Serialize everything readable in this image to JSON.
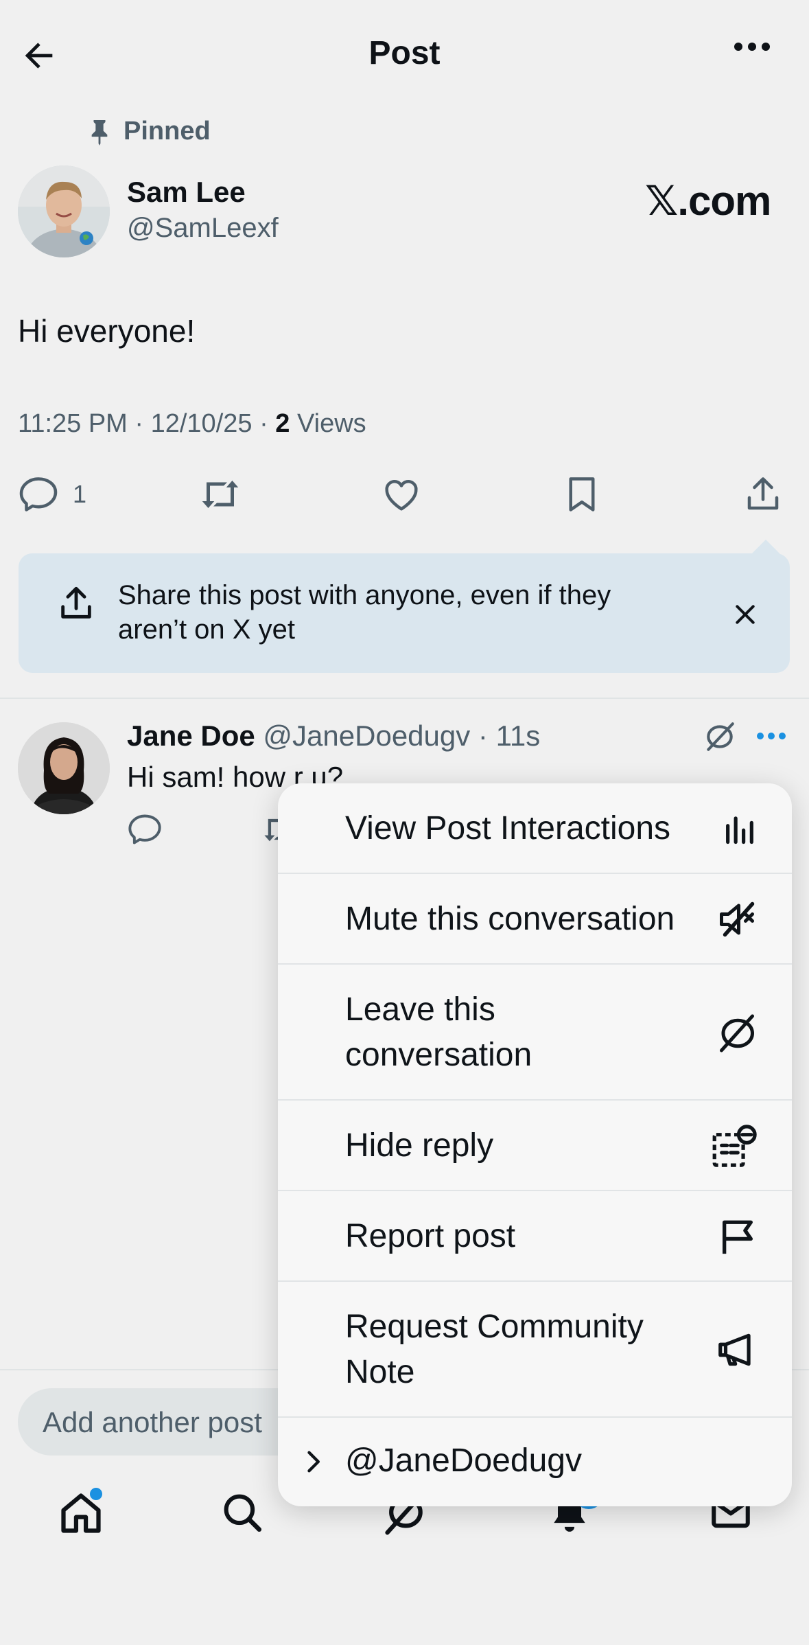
{
  "header": {
    "title": "Post"
  },
  "post": {
    "pinned_label": "Pinned",
    "author_name": "Sam Lee",
    "author_handle": "@SamLeexf",
    "brand_text": "𝕏.com",
    "text": "Hi everyone!",
    "time": "11:25 PM · 12/10/25 · ",
    "views_count": "2",
    "views_label": " Views",
    "reply_count": "1"
  },
  "share_banner": {
    "text": "Share this post with anyone, even if they aren’t on X yet"
  },
  "reply": {
    "author_name": "Jane Doe",
    "author_handle": "@JaneDoedugv",
    "time": " · 11s",
    "text": "Hi sam! how r u?"
  },
  "compose": {
    "placeholder": "Add another post"
  },
  "nav": {
    "notifications_badge": "1"
  },
  "menu": {
    "items": [
      {
        "label": "View Post Interactions",
        "icon": "chart-bars-icon"
      },
      {
        "label": "Mute this conversation",
        "icon": "mute-icon"
      },
      {
        "label": "Leave this conversation",
        "icon": "leave-conversation-icon"
      },
      {
        "label": "Hide reply",
        "icon": "hide-reply-icon"
      },
      {
        "label": "Report post",
        "icon": "flag-icon"
      },
      {
        "label": "Request Community Note",
        "icon": "megaphone-icon"
      },
      {
        "label": "@JaneDoedugv",
        "icon": "chevron-right-icon"
      }
    ]
  },
  "colors": {
    "accent": "#1d9bf0",
    "text": "#0f1419",
    "secondary": "#536471",
    "banner": "#e8f5fd"
  }
}
